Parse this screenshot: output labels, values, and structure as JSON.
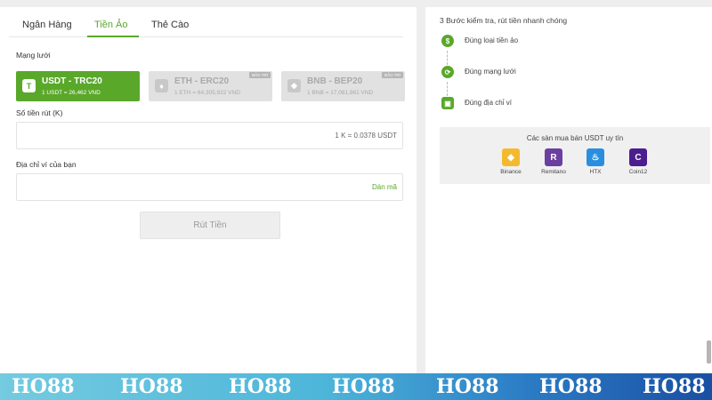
{
  "tabs": [
    {
      "label": "Ngân Hàng"
    },
    {
      "label": "Tiền Ảo"
    },
    {
      "label": "Thẻ Cào"
    }
  ],
  "network_label": "Mạng lưới",
  "networks": [
    {
      "icon": "tether-icon",
      "glyph": "T",
      "name": "USDT - TRC20",
      "rate": "1 USDT = 26,462 VND",
      "selected": true,
      "badge": ""
    },
    {
      "icon": "ethereum-icon",
      "glyph": "♦",
      "name": "ETH - ERC20",
      "rate": "1 ETH = 64,305,922 VND",
      "selected": false,
      "badge": "BẢO TRÌ"
    },
    {
      "icon": "binance-icon",
      "glyph": "◈",
      "name": "BNB - BEP20",
      "rate": "1 BNB = 17,081,961 VND",
      "selected": false,
      "badge": "BẢO TRÌ"
    }
  ],
  "amount": {
    "label": "Số tiền rút (K)",
    "rate_hint": "1 K = 0.0378 USDT",
    "value": ""
  },
  "wallet": {
    "label": "Địa chỉ ví của bạn",
    "paste": "Dán mã",
    "value": ""
  },
  "withdraw_button": "Rút Tiền",
  "steps_title": "3 Bước kiểm tra, rút tiền nhanh chóng",
  "steps": [
    {
      "icon": "coin-check-icon",
      "text": "Đúng loại tiền ảo"
    },
    {
      "icon": "network-check-icon",
      "text": "Đúng mạng lưới"
    },
    {
      "icon": "wallet-check-icon",
      "text": "Đúng địa chỉ ví"
    }
  ],
  "exchanges_title": "Các sàn mua bán USDT uy tín",
  "exchanges": [
    {
      "name": "Binance",
      "icon": "binance-logo-icon",
      "color": "#f3ba2f",
      "glyph": "◆"
    },
    {
      "name": "Remitano",
      "icon": "remitano-logo-icon",
      "color": "#6b3fa0",
      "glyph": "R"
    },
    {
      "name": "HTX",
      "icon": "htx-logo-icon",
      "color": "#2a8ee0",
      "glyph": "♨"
    },
    {
      "name": "Coin12",
      "icon": "coin12-logo-icon",
      "color": "#4b1d8f",
      "glyph": "C"
    }
  ],
  "watermark": [
    "HO88",
    "HO88",
    "HO88",
    "HO88",
    "HO88",
    "HO88",
    "HO88"
  ],
  "colors": {
    "accent": "#5aa82a",
    "disabled": "#e1e1e1"
  }
}
